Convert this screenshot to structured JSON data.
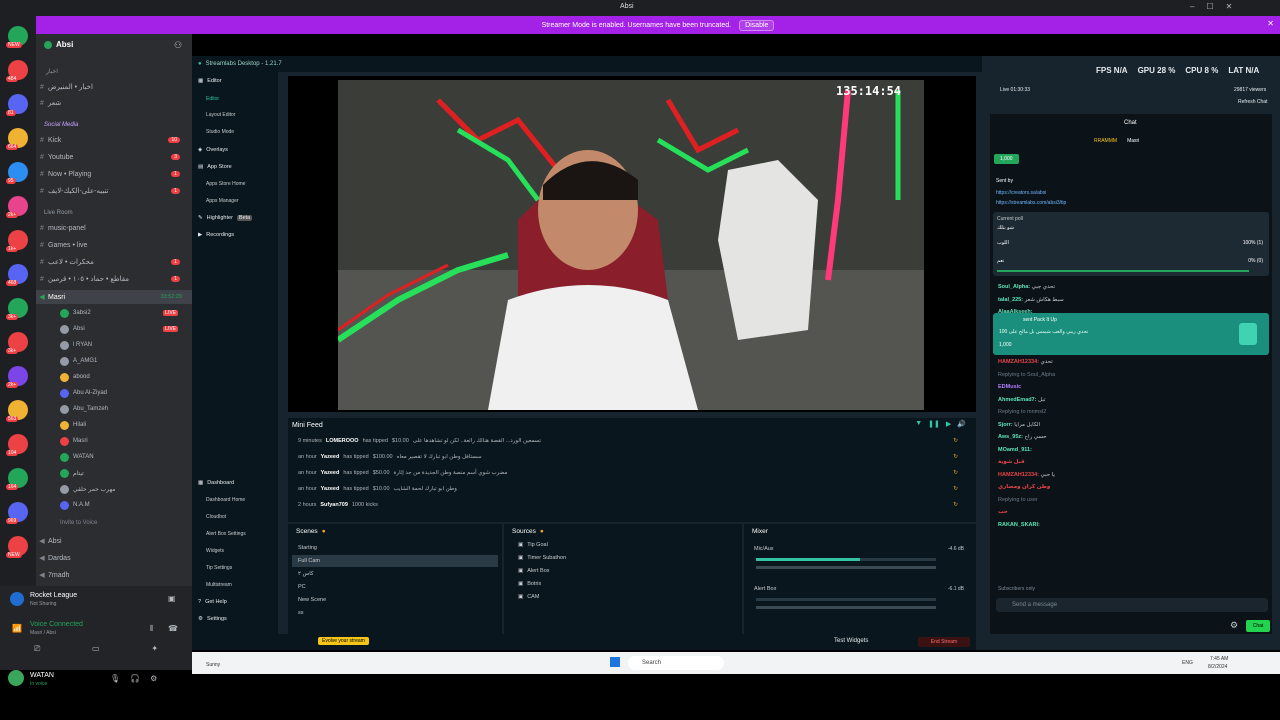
{
  "window": {
    "title": "Absi"
  },
  "banner": {
    "message": "Streamer Mode is enabled. Usernames have been truncated.",
    "disable_label": "Disable"
  },
  "rail": {
    "badges": [
      "NEW",
      "484",
      "81",
      "664",
      "95",
      "2k+",
      "1k+",
      "468",
      "3k+",
      "3k+",
      "2k+",
      "563",
      "104",
      "164",
      "969",
      "NEW"
    ]
  },
  "server": {
    "name": "Absi"
  },
  "sidebar": {
    "top_label": "اخبار",
    "top_channels": [
      {
        "name": "اخبار • المنيرض",
        "count": ""
      },
      {
        "name": "شعر",
        "count": ""
      }
    ],
    "categories": [
      {
        "name": "Social Media",
        "channels": [
          {
            "name": "Kick",
            "count": "10"
          },
          {
            "name": "Youtube",
            "count": "3"
          },
          {
            "name": "Now • Playing",
            "count": "1"
          },
          {
            "name": "تنبيه-على-الكيك-لايف",
            "count": "1"
          }
        ]
      },
      {
        "name": "Live Room",
        "channels": [
          {
            "name": "music-panel",
            "count": ""
          },
          {
            "name": "Games • live",
            "count": ""
          },
          {
            "name": "محكرات • لاعب",
            "count": "1"
          },
          {
            "name": "مقاطع • حماد • ١٠٥ • قرمين",
            "count": "1"
          }
        ]
      }
    ],
    "voice_channel": {
      "name": "Masri",
      "timer": "33:52:29"
    },
    "voice_users": [
      "3absi2",
      "Absi",
      "l RYAN",
      "A_AMG1",
      "abood",
      "Abu Al-Ziyad",
      "Abu_Tamzeh",
      "Hilali",
      "Masri",
      "WATAN",
      "تيتام",
      "مهرب حمر حلقي",
      "N.A.M"
    ],
    "live_users": [
      "3absi2",
      "Absi"
    ],
    "invite_label": "Invite to Voice",
    "bottom_channels": [
      "Absi",
      "Dardas",
      "7madh"
    ],
    "activity": {
      "title": "Rocket League",
      "subtitle": "Not Sharing"
    },
    "voice_status": {
      "label": "Voice Connected",
      "detail": "Masri / Absi"
    },
    "user": {
      "name": "WATAN",
      "status": "In voice"
    }
  },
  "streamlabs": {
    "title": "Streamlabs Desktop - 1.21.7",
    "nav": {
      "editor_section": "Editor",
      "editor_items": [
        "Editor",
        "Layout Editor",
        "Studio Mode"
      ],
      "overlays": "Overlays",
      "app_store_section": "App Store",
      "app_store_items": [
        "Apps Store Home",
        "Apps Manager"
      ],
      "highlighter": "Highlighter",
      "highlighter_badge": "Beta",
      "recordings": "Recordings",
      "dashboard_section": "Dashboard",
      "dashboard_items": [
        "Dashboard Home",
        "Cloudbot",
        "Alert Box Settings",
        "Widgets",
        "Tip Settings",
        "Multistream"
      ],
      "get_help": "Get Help",
      "settings": "Settings",
      "user": "absi"
    },
    "stream_timer": "135:14:54",
    "minifeed": {
      "title": "Mini Feed",
      "rows": [
        {
          "time": "9 minutes",
          "user": "LOMEROOO",
          "action": "has tipped",
          "amount": "$10.00",
          "msg": "تسمعين الورد... القصة هنالك رائعة.. لكن لو تشاهدها على"
        },
        {
          "time": "an hour",
          "user": "Yazeed",
          "action": "has tipped",
          "amount": "$100.00",
          "msg": "سستافل وطن ابو تبارك لا تقصير معاه"
        },
        {
          "time": "an hour",
          "user": "Yazeed",
          "action": "has tipped",
          "amount": "$50.00",
          "msg": "مضرب شوي أسم منصة وطن الجديدة من جد إثارة"
        },
        {
          "time": "an hour",
          "user": "Yazeed",
          "action": "has tipped",
          "amount": "$10.00",
          "msg": "وطن ابو تبارك لحمة الشايب"
        },
        {
          "time": "2 hours",
          "user": "Sufyan709",
          "action": "1000 kicks",
          "amount": "",
          "msg": ""
        }
      ]
    },
    "scenes": {
      "title": "Scenes",
      "items": [
        "Starting",
        "Full Cam",
        "كاس ٢",
        "PC",
        "New Scene",
        "ss"
      ],
      "active": 1
    },
    "sources": {
      "title": "Sources",
      "items": [
        "Tip Goal",
        "Timer Subathon",
        "Alert Box",
        "Botrix",
        "CAM"
      ]
    },
    "mixer": {
      "title": "Mixer",
      "channels": [
        {
          "name": "Mic/Aux",
          "db": "-4.6 dB",
          "level": 0.58
        },
        {
          "name": "Alert Box",
          "db": "-6.1 dB",
          "level": 0.0
        }
      ]
    },
    "footer": {
      "test_widgets": "Test Widgets",
      "evolve": "Evolve your stream",
      "go_live": "End Stream"
    }
  },
  "stats": {
    "fps_label": "FPS",
    "fps": "N/A",
    "gpu_label": "GPU",
    "gpu": "28 %",
    "cpu_label": "CPU",
    "cpu": "8 %",
    "lat_label": "LAT",
    "lat": "N/A"
  },
  "live_info": {
    "live": "Live 01:30:33",
    "viewers": "29817 viewers",
    "refresh": "Refresh Chat"
  },
  "chat": {
    "title": "Chat",
    "pinned_users": [
      "RRAMMM",
      "Masri"
    ],
    "kicks": "1,000",
    "sent_by": "Sent by",
    "link1": "https://creators.sa/absi",
    "link2": "https://streamlabs.com/absi3/tip",
    "poll": {
      "label": "Current poll",
      "question": "شو بتلك",
      "options": [
        {
          "label": "اللوب",
          "value": "100% (1)"
        },
        {
          "label": "نعم",
          "value": "0% (0)"
        }
      ]
    },
    "pack": {
      "text": "sent Pack It Up",
      "msg": "تحدي ريبي والعب شيمس بل مالح على 100",
      "amount": "1,000"
    },
    "lines": [
      {
        "user": "Soul_Alpha",
        "text": "تحدي جبي",
        "color": "nm"
      },
      {
        "user": "talal_225",
        "text": "سبط هكاش شعر",
        "color": "nm"
      },
      {
        "user": "AlaaAlkseeh",
        "text": "",
        "color": "nm"
      },
      {
        "user": "mnmsl2",
        "text": "بطل",
        "color": "nm"
      },
      {
        "user": "",
        "text": "ارجع اي وقت",
        "color": "nm2"
      },
      {
        "user": "",
        "text": "هاي جيب شعر",
        "color": "nm2"
      },
      {
        "user": "HAMZAH12334",
        "text": "تحدي",
        "color": "nm2"
      },
      {
        "user": "",
        "text": "Replying to Soul_Alpha",
        "color": ""
      },
      {
        "user": "",
        "text": "EDMusic",
        "color": "nm3"
      },
      {
        "user": "AhmedEmad7",
        "text": "تبل",
        "color": "nm"
      },
      {
        "user": "",
        "text": "Replying to mnmsl2",
        "color": ""
      },
      {
        "user": "Sjorr",
        "text": "الكابل مرايا",
        "color": "nm"
      },
      {
        "user": "Aws_95z",
        "text": "حسي راح",
        "color": "nm"
      },
      {
        "user": "MOamd_911",
        "text": "",
        "color": "nm"
      },
      {
        "user": "",
        "text": "قبل شوية",
        "color": "nm2"
      },
      {
        "user": "HAMZAH12334",
        "text": "يا حبي",
        "color": "nm2"
      },
      {
        "user": "",
        "text": "وطن كران ومصاري",
        "color": "nm2"
      },
      {
        "user": "",
        "text": "Replying to user",
        "color": ""
      },
      {
        "user": "",
        "text": "حب",
        "color": "nm2"
      },
      {
        "user": "RAKAN_SKARI",
        "text": "",
        "color": "nm"
      }
    ],
    "subscribers_only": "Subscribers only",
    "send_placeholder": "Send a message",
    "chat_button": "Chat"
  },
  "taskbar": {
    "weather": "Sunny",
    "search": "Search",
    "time": "7:45 AM",
    "date": "8/2/2024",
    "lang": "ENG"
  }
}
